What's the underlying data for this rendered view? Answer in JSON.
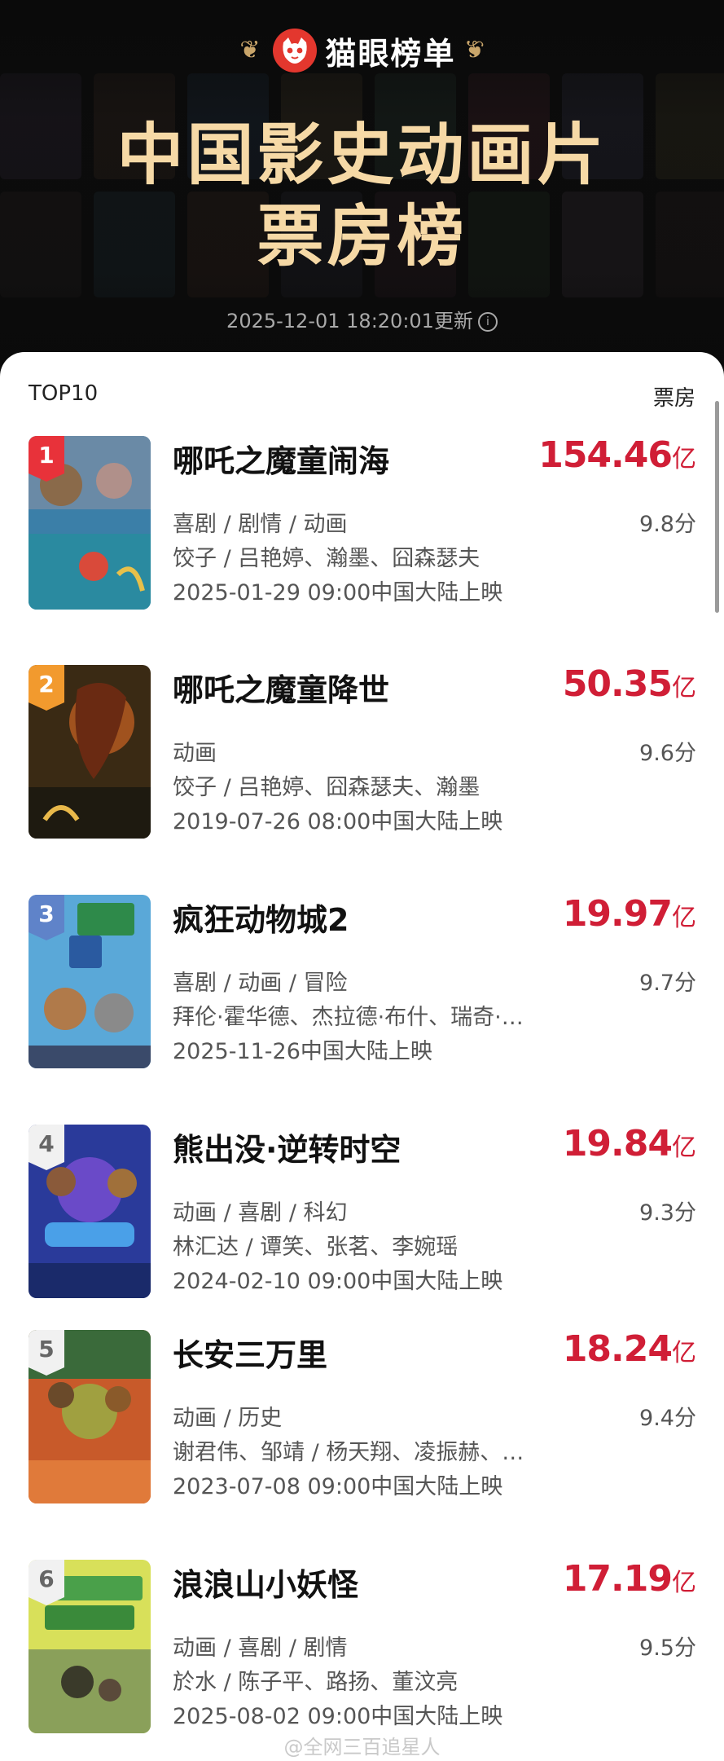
{
  "brand": {
    "name": "猫眼榜单"
  },
  "hero": {
    "title_line1": "中国影史动画片",
    "title_line2": "票房榜",
    "updated": "2025-12-01 18:20:01更新"
  },
  "list": {
    "header_left": "TOP10",
    "header_right": "票房",
    "items": [
      {
        "rank": "1",
        "title": "哪吒之魔童闹海",
        "box": "154.46",
        "unit": "亿",
        "genres": "喜剧 / 剧情 / 动画",
        "score": "9.8分",
        "cast": "饺子 / 吕艳婷、瀚墨、囧森瑟夫",
        "release": "2025-01-29 09:00中国大陆上映"
      },
      {
        "rank": "2",
        "title": "哪吒之魔童降世",
        "box": "50.35",
        "unit": "亿",
        "genres": "动画",
        "score": "9.6分",
        "cast": "饺子 / 吕艳婷、囧森瑟夫、瀚墨",
        "release": "2019-07-26 08:00中国大陆上映"
      },
      {
        "rank": "3",
        "title": "疯狂动物城2",
        "box": "19.97",
        "unit": "亿",
        "genres": "喜剧 / 动画 / 冒险",
        "score": "9.7分",
        "cast": "拜伦·霍华德、杰拉德·布什、瑞奇·…",
        "release": "2025-11-26中国大陆上映"
      },
      {
        "rank": "4",
        "title": "熊出没·逆转时空",
        "box": "19.84",
        "unit": "亿",
        "genres": "动画 / 喜剧 / 科幻",
        "score": "9.3分",
        "cast": "林汇达 / 谭笑、张茗、李婉瑶",
        "release": "2024-02-10 09:00中国大陆上映"
      },
      {
        "rank": "5",
        "title": "长安三万里",
        "box": "18.24",
        "unit": "亿",
        "genres": "动画 / 历史",
        "score": "9.4分",
        "cast": "谢君伟、邹靖 / 杨天翔、凌振赫、…",
        "release": "2023-07-08 09:00中国大陆上映"
      },
      {
        "rank": "6",
        "title": "浪浪山小妖怪",
        "box": "17.19",
        "unit": "亿",
        "genres": "动画 / 喜剧 / 剧情",
        "score": "9.5分",
        "cast": "於水 / 陈子平、路扬、董汶亮",
        "release": "2025-08-02 09:00中国大陆上映"
      }
    ]
  },
  "watermark": "@全网三百追星人",
  "colors": {
    "accent": "#d01e36",
    "brand_red": "#e3372e",
    "hero_gold": "#f6d9a6",
    "background_dark": "#0d0d0d"
  },
  "icons": [
    "laurel-left-icon",
    "cat-logo-icon",
    "laurel-right-icon",
    "info-icon"
  ]
}
